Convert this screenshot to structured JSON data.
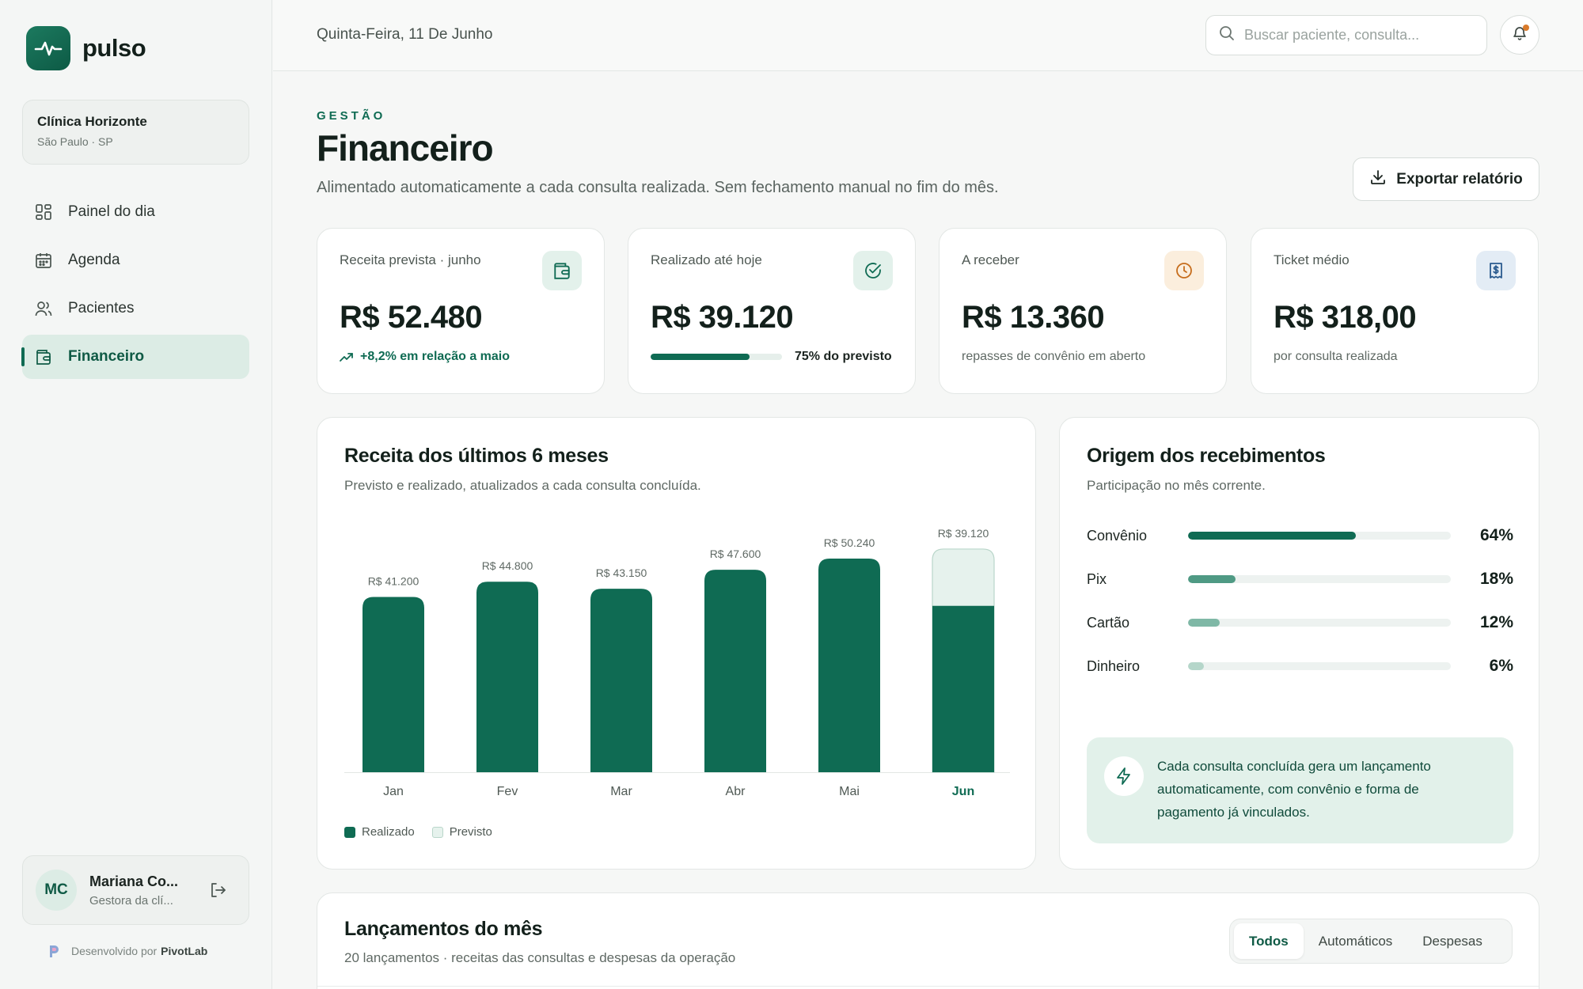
{
  "app": {
    "name": "pulso"
  },
  "clinic": {
    "name": "Clínica Horizonte",
    "location": "São Paulo · SP"
  },
  "nav": [
    {
      "label": "Painel do dia",
      "icon": "grid-icon",
      "active": false
    },
    {
      "label": "Agenda",
      "icon": "calendar-icon",
      "active": false
    },
    {
      "label": "Pacientes",
      "icon": "users-icon",
      "active": false
    },
    {
      "label": "Financeiro",
      "icon": "wallet-icon",
      "active": true
    }
  ],
  "user": {
    "initials": "MC",
    "name": "Mariana Co...",
    "role": "Gestora da clí..."
  },
  "credit": {
    "prefix": "Desenvolvido por",
    "brand": "PivotLab"
  },
  "topbar": {
    "date": "Quinta-Feira, 11 De Junho",
    "search_placeholder": "Buscar paciente, consulta..."
  },
  "header": {
    "eyebrow": "GESTÃO",
    "title": "Financeiro",
    "subtitle": "Alimentado automaticamente a cada consulta realizada. Sem fechamento manual no fim do mês.",
    "export_label": "Exportar relatório"
  },
  "kpis": [
    {
      "label": "Receita prevista · junho",
      "value": "R$ 52.480",
      "foot": "+8,2% em relação a maio",
      "icon": "wallet-icon",
      "icon_bg": "#e3f1eb",
      "icon_color": "#0f6b53"
    },
    {
      "label": "Realizado até hoje",
      "value": "R$ 39.120",
      "foot": "75% do previsto",
      "progress": 0.75,
      "icon": "check-circle-icon",
      "icon_bg": "#e3f1eb",
      "icon_color": "#0f6b53"
    },
    {
      "label": "A receber",
      "value": "R$ 13.360",
      "foot": "repasses de convênio em aberto",
      "icon": "clock-icon",
      "icon_bg": "#fbeedd",
      "icon_color": "#c66d1c"
    },
    {
      "label": "Ticket médio",
      "value": "R$ 318,00",
      "foot": "por consulta realizada",
      "icon": "receipt-icon",
      "icon_bg": "#e3ecf5",
      "icon_color": "#2b5b8f"
    }
  ],
  "revenue_chart": {
    "title": "Receita dos últimos 6 meses",
    "subtitle": "Previsto e realizado, atualizados a cada consulta concluída.",
    "legend": [
      "Realizado",
      "Previsto"
    ]
  },
  "chart_data": {
    "type": "bar",
    "categories": [
      "Jan",
      "Fev",
      "Mar",
      "Abr",
      "Mai",
      "Jun"
    ],
    "series": [
      {
        "name": "Realizado",
        "values": [
          41200,
          44800,
          43150,
          47600,
          50240,
          39120
        ]
      },
      {
        "name": "Previsto",
        "values": [
          null,
          null,
          null,
          null,
          null,
          52480
        ]
      }
    ],
    "labels": [
      "R$ 41.200",
      "R$ 44.800",
      "R$ 43.150",
      "R$ 47.600",
      "R$ 50.240",
      "R$ 39.120"
    ],
    "highlight": "Jun",
    "colors": {
      "realizado": "#0f6b53",
      "previsto": "#e6f2ed",
      "previsto_border": "#b9d6ca"
    },
    "grid": false,
    "legend_position": "bottom-left"
  },
  "origin": {
    "title": "Origem dos recebimentos",
    "subtitle": "Participação no mês corrente.",
    "rows": [
      {
        "label": "Convênio",
        "pct": 64,
        "pct_label": "64%",
        "color": "#0f6b53"
      },
      {
        "label": "Pix",
        "pct": 18,
        "pct_label": "18%",
        "color": "#4f9a84"
      },
      {
        "label": "Cartão",
        "pct": 12,
        "pct_label": "12%",
        "color": "#7fb8a6"
      },
      {
        "label": "Dinheiro",
        "pct": 6,
        "pct_label": "6%",
        "color": "#b5d6ca"
      }
    ],
    "info": "Cada consulta concluída gera um lançamento automaticamente, com convênio e forma de pagamento já vinculados."
  },
  "entries": {
    "title": "Lançamentos do mês",
    "subtitle": "20 lançamentos · receitas das consultas e despesas da operação",
    "filters": [
      {
        "label": "Todos",
        "active": true
      },
      {
        "label": "Automáticos",
        "active": false
      },
      {
        "label": "Despesas",
        "active": false
      }
    ]
  }
}
